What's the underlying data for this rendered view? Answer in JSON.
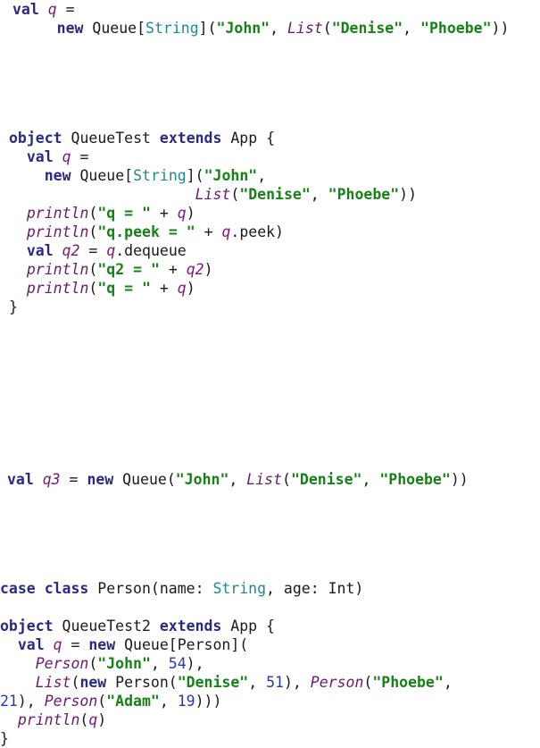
{
  "colors": {
    "keyword": "#2a2a80",
    "string": "#188018",
    "variable": "#7a167a",
    "function": "#6a1a6a",
    "type": "#22888a",
    "number": "#2a3aa0",
    "plain": "#1a1a1a"
  },
  "blocks": [
    {
      "name": "code-block-queue-declaration",
      "lines": [
        [
          [
            "kw",
            "val"
          ],
          [
            "p",
            " "
          ],
          [
            "var",
            "q"
          ],
          [
            "p",
            " ="
          ]
        ],
        [
          [
            "p",
            "     "
          ],
          [
            "kw",
            "new"
          ],
          [
            "p",
            " Queue["
          ],
          [
            "type",
            "String"
          ],
          [
            "p",
            "]("
          ],
          [
            "str",
            "\"John\""
          ],
          [
            "p",
            ", "
          ],
          [
            "fn",
            "List"
          ],
          [
            "p",
            "("
          ],
          [
            "str",
            "\"Denise\""
          ],
          [
            "p",
            ", "
          ],
          [
            "str",
            "\"Phoebe\""
          ],
          [
            "p",
            "))"
          ]
        ]
      ]
    },
    {
      "name": "code-block-queuetest-object",
      "lines": [
        [
          [
            "kw",
            "object"
          ],
          [
            "p",
            " QueueTest "
          ],
          [
            "kw",
            "extends"
          ],
          [
            "p",
            " App {"
          ]
        ],
        [
          [
            "p",
            "  "
          ],
          [
            "kw",
            "val"
          ],
          [
            "p",
            " "
          ],
          [
            "var",
            "q"
          ],
          [
            "p",
            " ="
          ]
        ],
        [
          [
            "p",
            "    "
          ],
          [
            "kw",
            "new"
          ],
          [
            "p",
            " Queue["
          ],
          [
            "type",
            "String"
          ],
          [
            "p",
            "]("
          ],
          [
            "str",
            "\"John\""
          ],
          [
            "p",
            ","
          ]
        ],
        [
          [
            "p",
            "                     "
          ],
          [
            "fn",
            "List"
          ],
          [
            "p",
            "("
          ],
          [
            "str",
            "\"Denise\""
          ],
          [
            "p",
            ", "
          ],
          [
            "str",
            "\"Phoebe\""
          ],
          [
            "p",
            "))"
          ]
        ],
        [
          [
            "p",
            "  "
          ],
          [
            "fn",
            "println"
          ],
          [
            "p",
            "("
          ],
          [
            "str",
            "\"q = \""
          ],
          [
            "p",
            " + "
          ],
          [
            "var",
            "q"
          ],
          [
            "p",
            ")"
          ]
        ],
        [
          [
            "p",
            "  "
          ],
          [
            "fn",
            "println"
          ],
          [
            "p",
            "("
          ],
          [
            "str",
            "\"q.peek = \""
          ],
          [
            "p",
            " + "
          ],
          [
            "var",
            "q"
          ],
          [
            "p",
            ".peek)"
          ]
        ],
        [
          [
            "p",
            "  "
          ],
          [
            "kw",
            "val"
          ],
          [
            "p",
            " "
          ],
          [
            "var",
            "q2"
          ],
          [
            "p",
            " = "
          ],
          [
            "var",
            "q"
          ],
          [
            "p",
            ".dequeue"
          ]
        ],
        [
          [
            "p",
            "  "
          ],
          [
            "fn",
            "println"
          ],
          [
            "p",
            "("
          ],
          [
            "str",
            "\"q2 = \""
          ],
          [
            "p",
            " + "
          ],
          [
            "var",
            "q2"
          ],
          [
            "p",
            ")"
          ]
        ],
        [
          [
            "p",
            "  "
          ],
          [
            "fn",
            "println"
          ],
          [
            "p",
            "("
          ],
          [
            "str",
            "\"q = \""
          ],
          [
            "p",
            " + "
          ],
          [
            "var",
            "q"
          ],
          [
            "p",
            ")"
          ]
        ],
        [
          [
            "p",
            "}"
          ]
        ]
      ]
    },
    {
      "name": "code-block-q3-declaration",
      "lines": [
        [
          [
            "kw",
            "val"
          ],
          [
            "p",
            " "
          ],
          [
            "var",
            "q3"
          ],
          [
            "p",
            " = "
          ],
          [
            "kw",
            "new"
          ],
          [
            "p",
            " Queue("
          ],
          [
            "str",
            "\"John\""
          ],
          [
            "p",
            ", "
          ],
          [
            "fn",
            "List"
          ],
          [
            "p",
            "("
          ],
          [
            "str",
            "\"Denise\""
          ],
          [
            "p",
            ", "
          ],
          [
            "str",
            "\"Phoebe\""
          ],
          [
            "p",
            "))"
          ]
        ]
      ]
    },
    {
      "name": "code-block-person-queuetest2",
      "lines": [
        [
          [
            "kw",
            "case"
          ],
          [
            "p",
            " "
          ],
          [
            "kw",
            "class"
          ],
          [
            "p",
            " Person(name: "
          ],
          [
            "type",
            "String"
          ],
          [
            "p",
            ", age: Int)"
          ]
        ],
        [
          [
            "p",
            ""
          ]
        ],
        [
          [
            "kw",
            "object"
          ],
          [
            "p",
            " QueueTest2 "
          ],
          [
            "kw",
            "extends"
          ],
          [
            "p",
            " App {"
          ]
        ],
        [
          [
            "p",
            "  "
          ],
          [
            "kw",
            "val"
          ],
          [
            "p",
            " "
          ],
          [
            "var",
            "q"
          ],
          [
            "p",
            " = "
          ],
          [
            "kw",
            "new"
          ],
          [
            "p",
            " Queue[Person]("
          ]
        ],
        [
          [
            "p",
            "    "
          ],
          [
            "fn",
            "Person"
          ],
          [
            "p",
            "("
          ],
          [
            "str",
            "\"John\""
          ],
          [
            "p",
            ", "
          ],
          [
            "num",
            "54"
          ],
          [
            "p",
            "),"
          ]
        ],
        [
          [
            "p",
            "    "
          ],
          [
            "fn",
            "List"
          ],
          [
            "p",
            "("
          ],
          [
            "kw",
            "new"
          ],
          [
            "p",
            " Person("
          ],
          [
            "str",
            "\"Denise\""
          ],
          [
            "p",
            ", "
          ],
          [
            "num",
            "51"
          ],
          [
            "p",
            "), "
          ],
          [
            "fn",
            "Person"
          ],
          [
            "p",
            "("
          ],
          [
            "str",
            "\"Phoebe\""
          ],
          [
            "p",
            ","
          ]
        ],
        [
          [
            "num",
            "21"
          ],
          [
            "p",
            "), "
          ],
          [
            "fn",
            "Person"
          ],
          [
            "p",
            "("
          ],
          [
            "str",
            "\"Adam\""
          ],
          [
            "p",
            ", "
          ],
          [
            "num",
            "19"
          ],
          [
            "p",
            ")))"
          ]
        ],
        [
          [
            "p",
            "  "
          ],
          [
            "fn",
            "println"
          ],
          [
            "p",
            "("
          ],
          [
            "var",
            "q"
          ],
          [
            "p",
            ")"
          ]
        ],
        [
          [
            "p",
            "}"
          ]
        ]
      ]
    }
  ]
}
